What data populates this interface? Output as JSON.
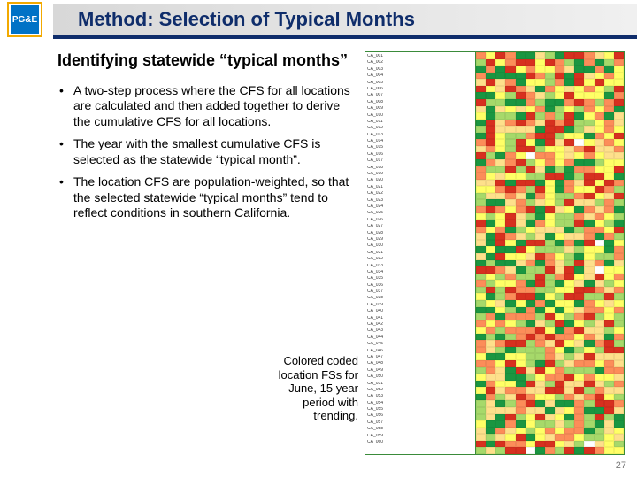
{
  "logo_text": "PG&E",
  "title": "Method: Selection of Typical Months",
  "subhead": "Identifying statewide “typical months”",
  "bullets": [
    "A two-step process where the CFS for all locations are calculated and then added together to derive the cumulative CFS for all locations.",
    "The year with the smallest cumulative CFS is selected as the statewide “typical month”.",
    "The location CFS are population-weighted, so that the selected statewide “typical months” tend to reflect conditions in southern California."
  ],
  "caption": "Colored coded location FSs for June, 15 year period with trending.",
  "page_number": "27",
  "heatmap": {
    "rows": 60,
    "cols": 15,
    "row_label_prefix": "CA_"
  }
}
